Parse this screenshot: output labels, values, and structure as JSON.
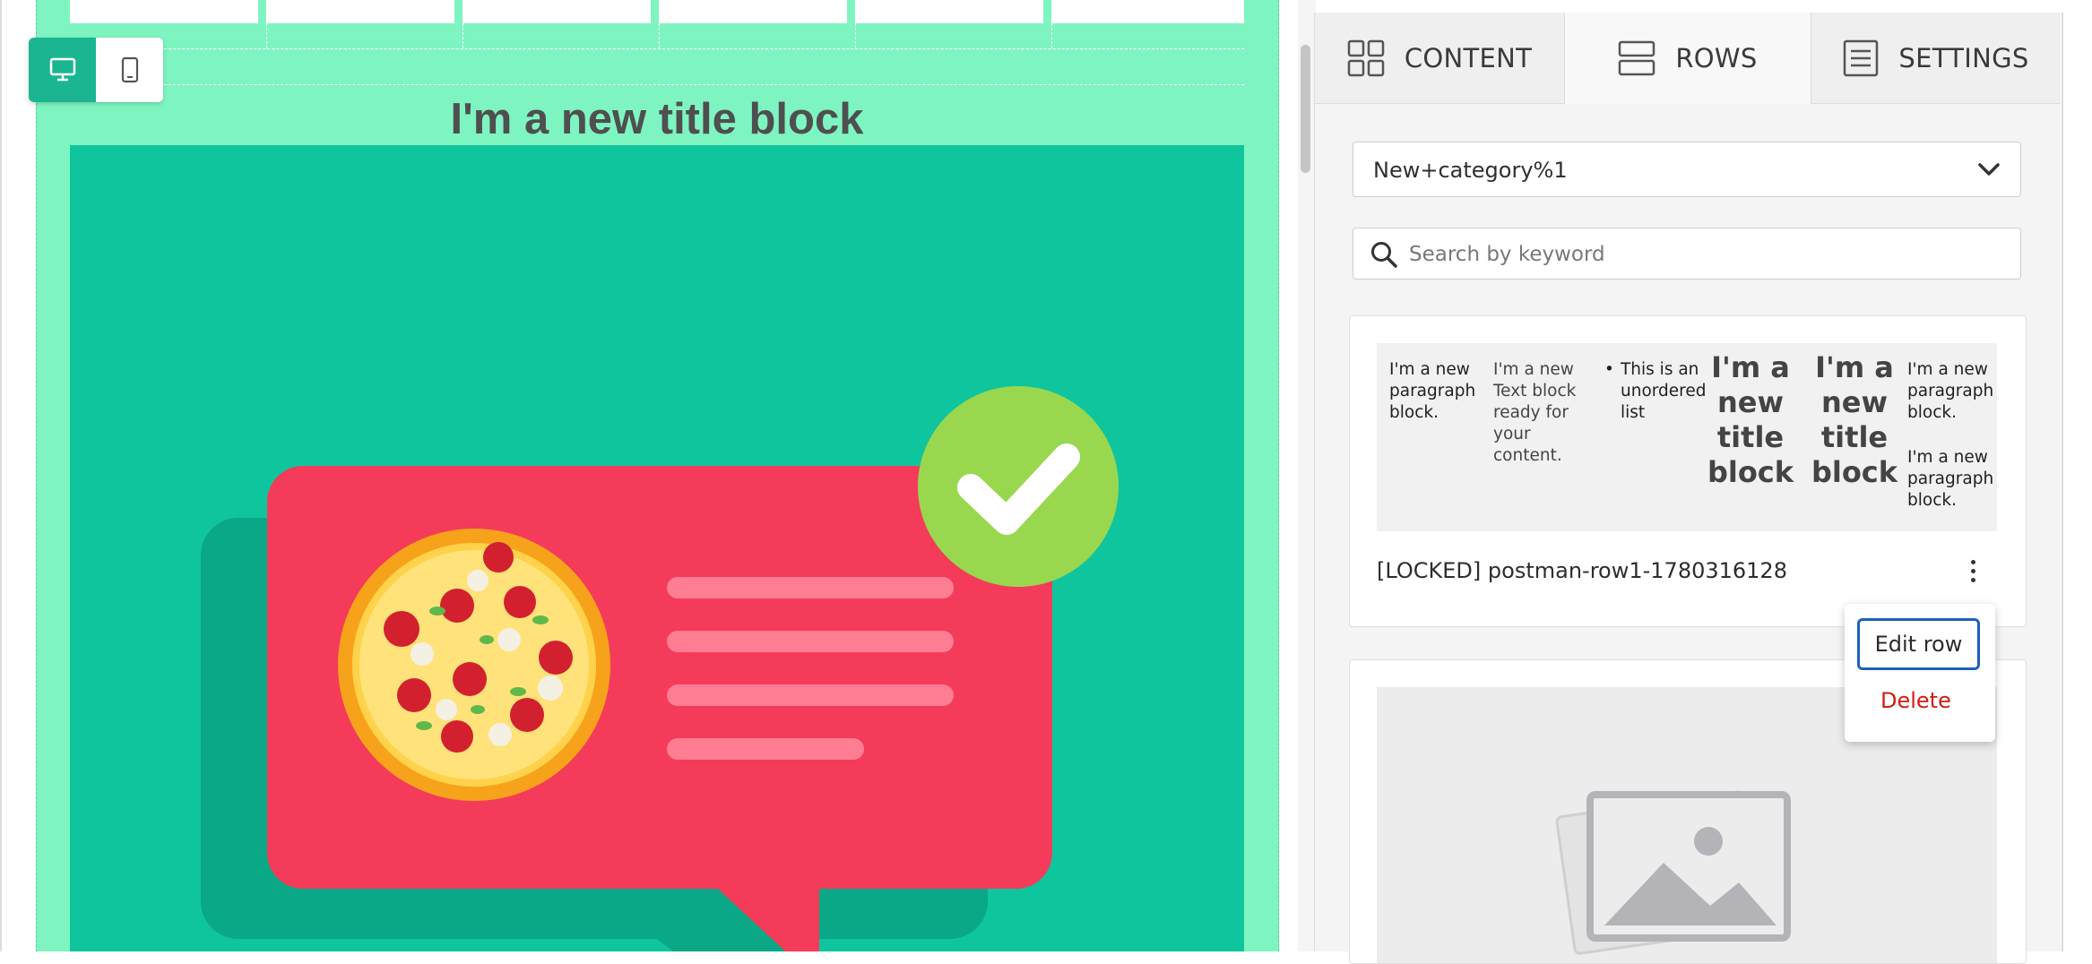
{
  "canvas": {
    "title_block_text": "I'm a new title block",
    "device_toggle": {
      "desktop_icon": "desktop-icon",
      "mobile_icon": "mobile-icon",
      "active": "desktop"
    },
    "colors": {
      "row_background": "#7ef5c1",
      "hero_background": "#0fc59e",
      "bubble": "#f43b5a",
      "check_circle": "#99d84e"
    }
  },
  "panel": {
    "tabs": [
      {
        "label": "CONTENT",
        "icon": "grid-icon"
      },
      {
        "label": "ROWS",
        "icon": "rows-icon",
        "active": true
      },
      {
        "label": "SETTINGS",
        "icon": "settings-list-icon"
      }
    ],
    "category_select": {
      "value": "New+category%1"
    },
    "search": {
      "placeholder": "Search by keyword",
      "value": ""
    },
    "row_cards": [
      {
        "name": "[LOCKED] postman-row1-1780316128",
        "thumbnail": {
          "paragraph_1": "I'm a new paragraph block.",
          "text_block": "I'm a new Text block ready for your content.",
          "list_item": "This is an unordered list",
          "title_1": "I'm a new title block",
          "title_2": "I'm a new title block",
          "paragraph_2": "I'm a new paragraph block.",
          "paragraph_3": "I'm a new paragraph block."
        }
      },
      {
        "name": "",
        "thumbnail_icon": "image-placeholder-icon"
      }
    ],
    "context_menu": {
      "edit_label": "Edit row",
      "delete_label": "Delete",
      "delete_color": "#d21b12"
    }
  }
}
